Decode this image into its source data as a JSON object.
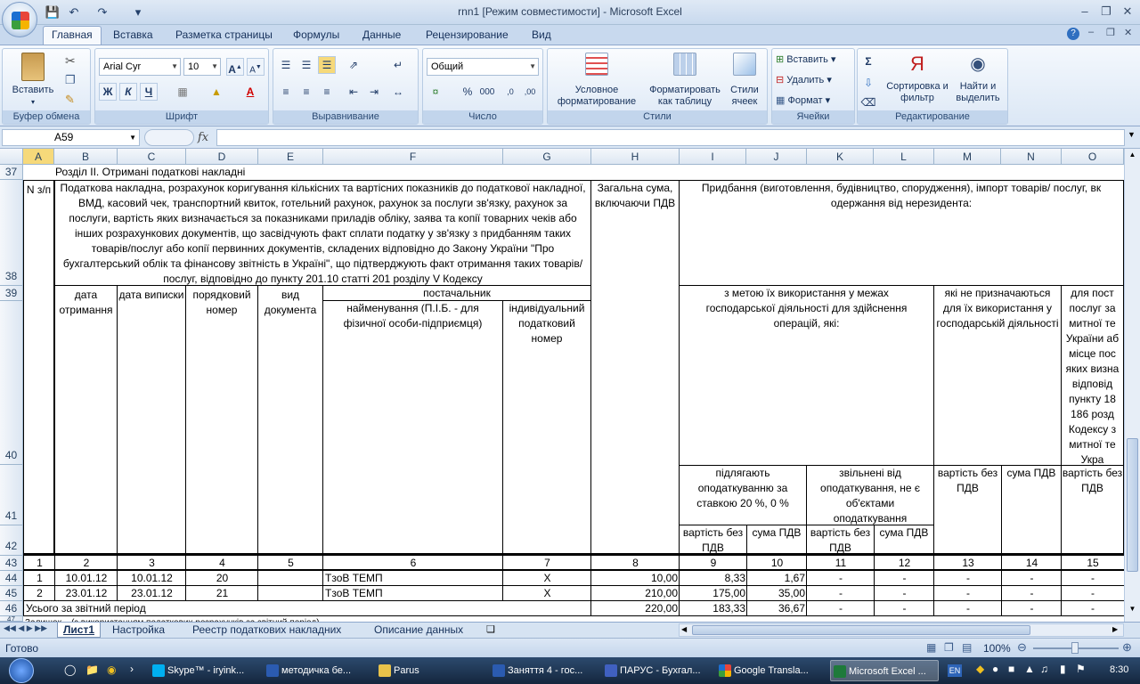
{
  "window": {
    "title": "rnn1  [Режим совместимости] - Microsoft Excel"
  },
  "ribbon": {
    "tabs": [
      "Главная",
      "Вставка",
      "Разметка страницы",
      "Формулы",
      "Данные",
      "Рецензирование",
      "Вид"
    ],
    "clipboard": {
      "paste": "Вставить",
      "label": "Буфер обмена"
    },
    "font": {
      "name": "Arial Cyr",
      "size": "10",
      "bold": "Ж",
      "italic": "К",
      "underline": "Ч",
      "label": "Шрифт"
    },
    "alignment": {
      "label": "Выравнивание"
    },
    "number": {
      "format": "Общий",
      "label": "Число"
    },
    "styles": {
      "conditional": "Условное форматирование",
      "as_table": "Форматировать как таблицу",
      "cell_styles": "Стили ячеек",
      "label": "Стили"
    },
    "cells": {
      "insert": "Вставить",
      "delete": "Удалить",
      "format": "Формат",
      "label": "Ячейки"
    },
    "editing": {
      "sort": "Сортировка и фильтр",
      "find": "Найти и выделить",
      "label": "Редактирование"
    }
  },
  "formula_bar": {
    "name_box": "A59",
    "fx": "fx",
    "value": ""
  },
  "columns": [
    "A",
    "B",
    "C",
    "D",
    "E",
    "F",
    "G",
    "H",
    "I",
    "J",
    "K",
    "L",
    "M",
    "N",
    "O"
  ],
  "rows": [
    "37",
    "38",
    "39",
    "40",
    "41",
    "42",
    "43",
    "44",
    "45",
    "46",
    "47"
  ],
  "sheet": {
    "r37": "Розділ ІІ. Отримані податкові накладні",
    "h_n": "N з/п",
    "h_invoice": "Податкова накладна, розрахунок коригування кількісних та вартісних показників до податкової накладної, ВМД, касовий чек, транспортний квиток, готельний рахунок, рахунок за послуги зв'язку, рахунок за послуги, вартість яких визначається за показниками приладів обліку, заява та копії товарних чеків або інших розрахункових документів, що засвідчують факт сплати податку у зв'язку з придбанням таких товарів/послуг або копії первинних документів, складених відповідно до Закону України \"Про бухгалтерський облік та фінансову звітність в Україні\", що підтверджують факт отримання таких товарів/послуг, відповідно до пункту 201.10 статті 201 розділу V Кодексу",
    "h_total": "Загальна сума, включаючи ПДВ",
    "h_purchase": "Придбання (виготовлення, будівництво, спорудження), імпорт товарів/ послуг, вк одержання від нерезидента:",
    "h_date_recv": "дата отримання",
    "h_date_issue": "дата виписки",
    "h_serial": "порядковий номер",
    "h_doctype": "вид документа",
    "h_supplier": "постачальник",
    "h_name": "найменування  (П.І.Б. - для фізичної особи-підприємця)",
    "h_ipn": "індивідуальний податковий номер",
    "h_within": "з метою їх використання у межах господарської діяльності для здійснення операцій, які:",
    "h_not_for": "які не призначаються для їх використання у господарській діяльності",
    "h_for_post": "для пост послуг за митної те України аб місце пос яких визна відповід пункту 18 186 розд Кодексу з митної те Укра",
    "h_taxable": "підлягають оподаткуванню за ставкою 20 %, 0 %",
    "h_exempt": "звільнені від оподаткування, не є об'єктами оподаткування",
    "h_val_no_vat": "вартість без ПДВ",
    "h_sum_vat": "сума ПДВ",
    "nums": [
      "1",
      "2",
      "3",
      "4",
      "5",
      "6",
      "7",
      "8",
      "9",
      "10",
      "11",
      "12",
      "13",
      "14",
      "15"
    ],
    "data_rows": [
      {
        "n": "1",
        "recv": "10.01.12",
        "issue": "10.01.12",
        "serial": "20",
        "doctype": "",
        "name": "ТзоВ ТЕМП",
        "ipn": "Х",
        "total": "10,00",
        "c9": "8,33",
        "c10": "1,67",
        "c11": "-",
        "c12": "-",
        "c13": "-",
        "c14": "-",
        "c15": "-"
      },
      {
        "n": "2",
        "recv": "23.01.12",
        "issue": "23.01.12",
        "serial": "21",
        "doctype": "",
        "name": "ТзоВ ТЕМП",
        "ipn": "Х",
        "total": "210,00",
        "c9": "175,00",
        "c10": "35,00",
        "c11": "-",
        "c12": "-",
        "c13": "-",
        "c14": "-",
        "c15": "-"
      }
    ],
    "total_row": {
      "label": "Усього за звітний період",
      "total": "220,00",
      "c9": "183,33",
      "c10": "36,67",
      "c11": "-",
      "c12": "-",
      "c13": "-",
      "c14": "-",
      "c15": "-"
    },
    "r47": "Залишок... (з використанням податкових розрахунків за звітний період)"
  },
  "sheet_tabs": [
    "Лист1",
    "Настройка",
    "Реестр податкових накладних",
    "Описание данных"
  ],
  "status": {
    "ready": "Готово",
    "zoom": "100%"
  },
  "taskbar": {
    "items": [
      "Skype™ - iryink...",
      "методичка бе...",
      "Parus",
      "Заняття 4 - гос...",
      "ПАРУС - Бухгал...",
      "Google Transla...",
      "Microsoft Excel ..."
    ],
    "lang": "EN",
    "clock": "8:30"
  }
}
